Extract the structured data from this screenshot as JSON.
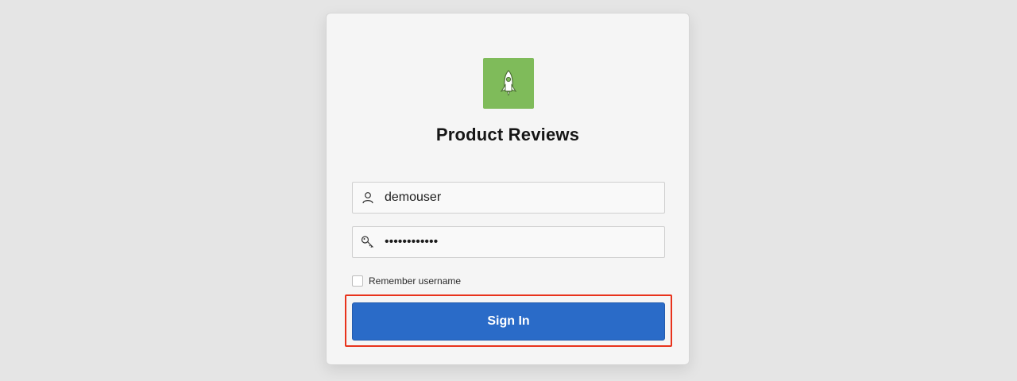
{
  "app": {
    "title": "Product Reviews",
    "logo_icon": "rocket-icon",
    "logo_color": "#7fbb5a"
  },
  "form": {
    "username": {
      "icon": "user-icon",
      "value": "demouser"
    },
    "password": {
      "icon": "key-icon",
      "value": "demouser1234"
    },
    "remember": {
      "label": "Remember username",
      "checked": false
    },
    "sign_in_label": "Sign In",
    "button_color": "#2a6bc8",
    "highlight_color": "#e8331c"
  }
}
